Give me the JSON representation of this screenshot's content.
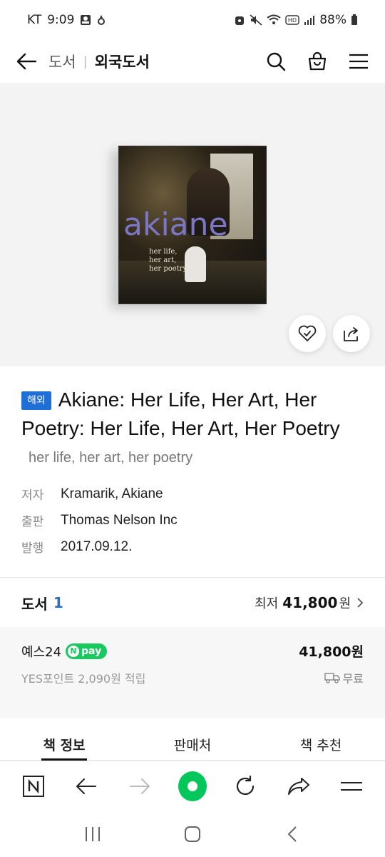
{
  "status_bar": {
    "carrier": "KT",
    "time": "9:09",
    "battery": "88%",
    "icons": [
      "profile-icon",
      "fire-icon",
      "alarm-icon",
      "mute-icon",
      "wifi-icon",
      "hd-icon",
      "signal-icon",
      "battery-icon"
    ]
  },
  "header": {
    "parent": "도서",
    "current": "외국도서",
    "icons": [
      "back-arrow-icon",
      "search-icon",
      "cart-icon",
      "menu-icon"
    ]
  },
  "cover": {
    "title": "akiane",
    "subtitle_lines": [
      "her life,",
      "her art,",
      "her poetry"
    ]
  },
  "product": {
    "tag": "해외",
    "title": "Akiane: Her Life, Her Art, Her Poetry: Her Life, Her Art, Her Poetry",
    "subtitle": "her life, her art, her poetry",
    "meta": [
      {
        "label": "저자",
        "value": "Kramarik, Akiane"
      },
      {
        "label": "출판",
        "value": "Thomas Nelson Inc"
      },
      {
        "label": "발행",
        "value": "2017.09.12."
      }
    ]
  },
  "book_offers": {
    "label": "도서",
    "count": "1",
    "lowest_label": "최저",
    "lowest_price": "41,800",
    "currency": "원"
  },
  "seller": {
    "name": "예스24",
    "pay_badge": "pay",
    "pay_badge_n": "N",
    "price": "41,800",
    "currency": "원",
    "points": "YES포인트 2,090원 적립",
    "shipping": "무료"
  },
  "tabs": [
    {
      "label": "책 정보",
      "active": true
    },
    {
      "label": "판매처",
      "active": false
    },
    {
      "label": "책 추천",
      "active": false
    }
  ],
  "browser_bar": {
    "icons": [
      "naver-n-icon",
      "back-icon",
      "forward-icon",
      "home-icon",
      "refresh-icon",
      "share-icon",
      "menu-icon"
    ]
  },
  "colors": {
    "accent_blue": "#1f6fd6",
    "count_blue": "#2b6fc4",
    "npay_green": "#19c960",
    "home_green": "#03c75a"
  }
}
